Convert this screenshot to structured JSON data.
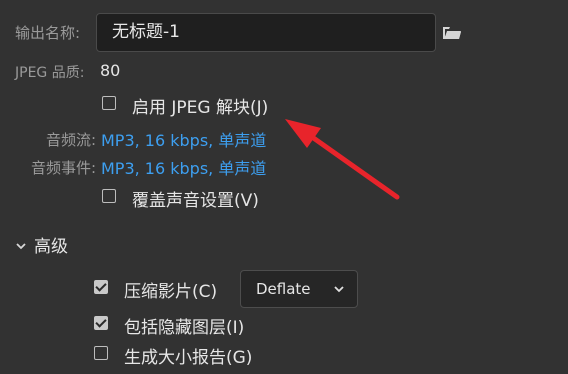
{
  "output_name": {
    "label": "输出名称:",
    "value": "无标题-1"
  },
  "jpeg_quality": {
    "label": "JPEG 品质:",
    "value": "80"
  },
  "jpeg_deblock": {
    "label": "启用 JPEG 解块(J)",
    "checked": false
  },
  "audio_stream": {
    "label": "音频流:",
    "value": "MP3, 16 kbps, 单声道"
  },
  "audio_event": {
    "label": "音频事件:",
    "value": "MP3, 16 kbps, 单声道"
  },
  "override_sound": {
    "label": "覆盖声音设置(V)",
    "checked": false
  },
  "advanced": {
    "label": "高级"
  },
  "compress_movie": {
    "label": "压缩影片(C)",
    "checked": true,
    "method": "Deflate"
  },
  "include_hidden": {
    "label": "包括隐藏图层(I)",
    "checked": true
  },
  "size_report": {
    "label": "生成大小报告(G)",
    "checked": false
  },
  "icons": {
    "folder": "folder-icon",
    "dropdown": "chevron-down-icon",
    "section_toggle": "chevron-down-icon",
    "annotation": "red-arrow"
  },
  "colors": {
    "background": "#323232",
    "link": "#3d9ff0",
    "arrow": "#e8242b"
  }
}
